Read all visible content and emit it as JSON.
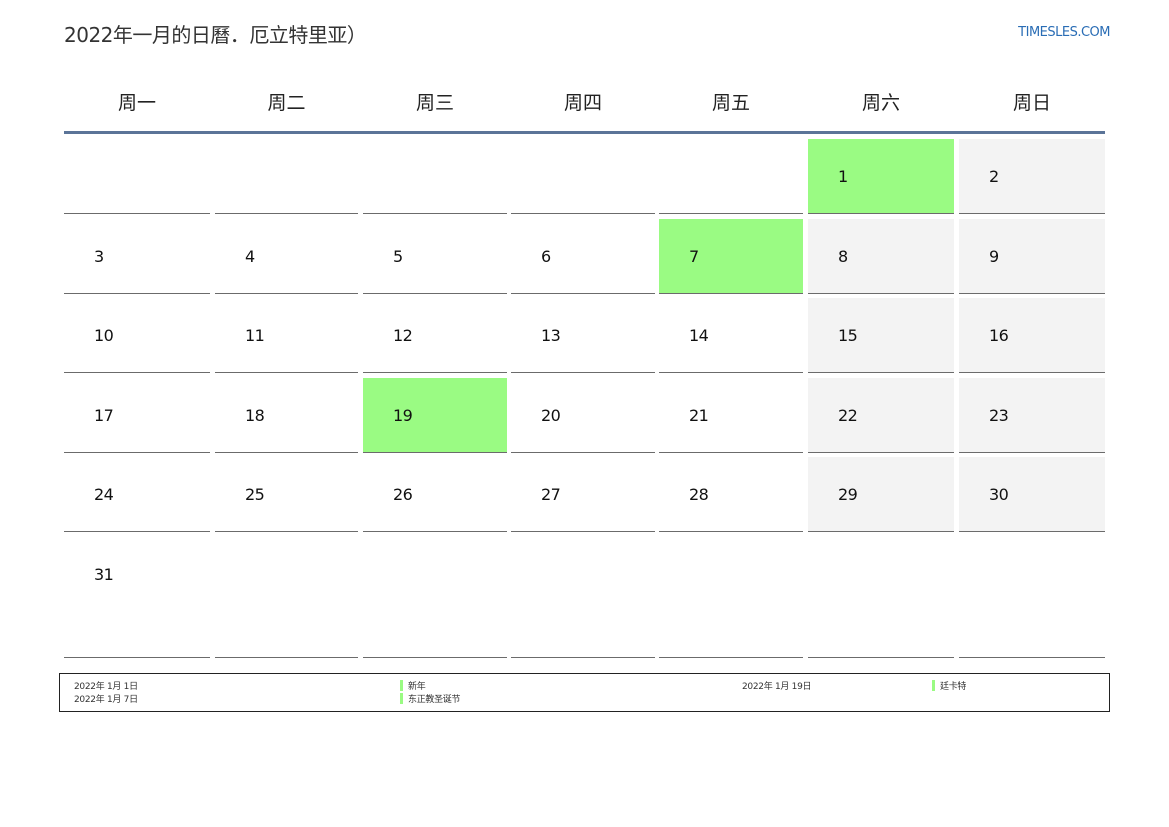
{
  "header": {
    "title": "2022年一月的日曆．厄立特里亚）",
    "site": "TIMESLES.COM"
  },
  "weekdays": [
    "周一",
    "周二",
    "周三",
    "周四",
    "周五",
    "周六",
    "周日"
  ],
  "weeks": [
    [
      "",
      "",
      "",
      "",
      "",
      "1",
      "2"
    ],
    [
      "3",
      "4",
      "5",
      "6",
      "7",
      "8",
      "9"
    ],
    [
      "10",
      "11",
      "12",
      "13",
      "14",
      "15",
      "16"
    ],
    [
      "17",
      "18",
      "19",
      "20",
      "21",
      "22",
      "23"
    ],
    [
      "24",
      "25",
      "26",
      "27",
      "28",
      "29",
      "30"
    ],
    [
      "31",
      "",
      "",
      "",
      "",
      "",
      ""
    ]
  ],
  "highlighted_days": [
    "1",
    "7",
    "19"
  ],
  "colors": {
    "holiday": "#9afb83",
    "weekend": "#f3f3f3",
    "header_rule": "#5b7498",
    "link": "#2a6db5"
  },
  "legend": {
    "holidays": [
      {
        "date": "2022年 1月 1日",
        "name": "新年"
      },
      {
        "date": "2022年 1月 7日",
        "name": "东正教圣诞节"
      },
      {
        "date": "2022年 1月 19日",
        "name": "廷卡特"
      }
    ]
  }
}
